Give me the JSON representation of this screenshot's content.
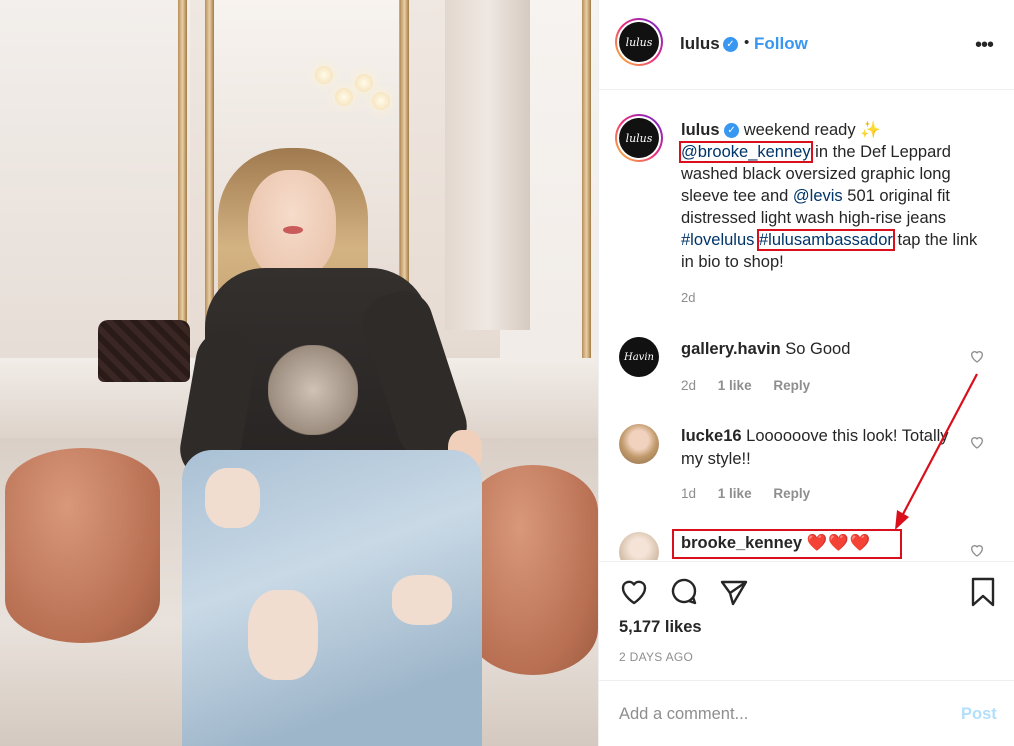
{
  "header": {
    "avatar_text": "lulus",
    "username": "lulus",
    "verified_icon": "verified-badge-icon",
    "separator": "•",
    "follow_label": "Follow",
    "more_icon": "•••"
  },
  "caption": {
    "username": "lulus",
    "text_1": "weekend ready ✨",
    "mention_1": "@brooke_kenney",
    "text_2": " in the Def Leppard washed black oversized graphic long sleeve tee and ",
    "mention_2": "@levis",
    "text_3": " 501 original fit distressed light wash high-rise jeans ",
    "hashtag_1": "#lovelulus",
    "hashtag_2": "#lulusambassador",
    "text_4": " tap the link in bio to shop!",
    "time": "2d"
  },
  "comments": [
    {
      "avatar_text": "Havin",
      "username": "gallery.havin",
      "text": "So Good",
      "time": "2d",
      "likes": "1 like",
      "reply": "Reply"
    },
    {
      "username": "lucke16",
      "text": "Loooooove this look! Totally my style!!",
      "time": "1d",
      "likes": "1 like",
      "reply": "Reply"
    },
    {
      "username": "brooke_kenney",
      "text": "❤️❤️❤️"
    }
  ],
  "actions": {
    "likes": "5,177 likes",
    "posted": "2 DAYS AGO",
    "comment_placeholder": "Add a comment...",
    "post_label": "Post"
  },
  "colors": {
    "accent": "#3897f0",
    "link": "#003569",
    "annotation_red": "#d9101b",
    "muted": "#8e8e8e"
  }
}
